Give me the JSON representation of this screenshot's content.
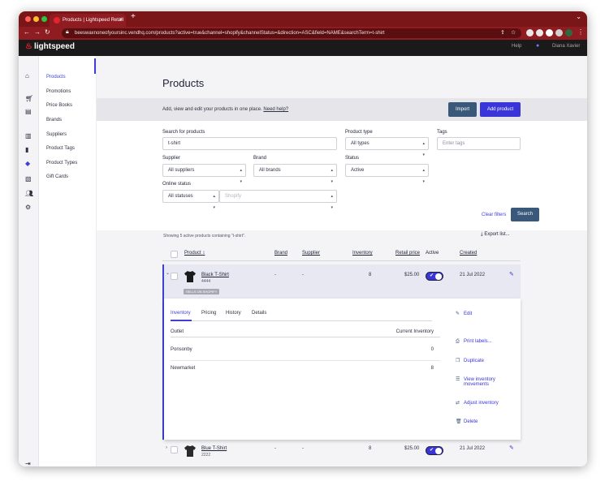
{
  "browser": {
    "tab_title": "Products | Lightspeed Retail",
    "tab_close": "×",
    "new_tab": "+",
    "url": "beeswaxnoneofyoursinc.vendhq.com/products?active=true&channel=shopify&channelStatus=&direction=ASC&field=NAME&searchTerm=t-shirt"
  },
  "appbar": {
    "brand": "lightspeed",
    "help": "Help",
    "user": "Diana Xavier"
  },
  "subnav": {
    "items": [
      {
        "label": "Products"
      },
      {
        "label": "Promotions"
      },
      {
        "label": "Price Books"
      },
      {
        "label": "Brands"
      },
      {
        "label": "Suppliers"
      },
      {
        "label": "Product Tags"
      },
      {
        "label": "Product Types"
      },
      {
        "label": "Gift Cards"
      }
    ]
  },
  "page": {
    "title": "Products",
    "info_text": "Add, view and edit your products in one place.",
    "help_link": "Need help?",
    "import_label": "Import",
    "add_label": "Add product"
  },
  "filters": {
    "search_label": "Search for products",
    "search_value": "t-shirt",
    "product_type_label": "Product type",
    "product_type_value": "All types",
    "tags_label": "Tags",
    "tags_placeholder": "Enter tags",
    "supplier_label": "Supplier",
    "supplier_value": "All suppliers",
    "brand_label": "Brand",
    "brand_value": "All brands",
    "status_label": "Status",
    "status_value": "Active",
    "online_label": "Online status",
    "online_value": "All statuses",
    "channel_value": "Shopify",
    "clear_label": "Clear filters",
    "search_button": "Search"
  },
  "results": {
    "showing_text": "Showing 5 active products containing \"t-shirt\".",
    "export_label": "Export list..."
  },
  "table": {
    "headers": {
      "product": "Product",
      "brand": "Brand",
      "supplier": "Supplier",
      "inventory": "Inventory",
      "retail_price": "Retail price",
      "active": "Active",
      "created": "Created"
    },
    "rows": [
      {
        "name": "Black T-Shirt",
        "sku": "4444",
        "tag": "SELLS ON SHOPIFY",
        "brand": "-",
        "supplier": "-",
        "inventory": "8",
        "price": "$25.00",
        "active": true,
        "created": "21 Jul 2022"
      },
      {
        "name": "Blue T-Shirt",
        "sku": "2222",
        "brand": "-",
        "supplier": "-",
        "inventory": "8",
        "price": "$25.00",
        "active": true,
        "created": "21 Jul 2022"
      }
    ]
  },
  "detail": {
    "tabs": [
      "Inventory",
      "Pricing",
      "History",
      "Details"
    ],
    "outlet_header": "Outlet",
    "current_header": "Current Inventory",
    "outlets": [
      {
        "name": "Ponsonby",
        "qty": "0"
      },
      {
        "name": "Newmarket",
        "qty": "8"
      }
    ],
    "actions": {
      "edit": "Edit",
      "print": "Print labels...",
      "duplicate": "Duplicate",
      "view_inventory_1": "View inventory",
      "view_inventory_2": "movements",
      "adjust": "Adjust inventory",
      "delete": "Delete"
    }
  },
  "colors": {
    "accent": "#3a35d9",
    "brand_red": "#e2242f",
    "primary_dark": "#3a587a",
    "chrome": "#8e1c20"
  },
  "icons": [
    "home-icon",
    "register-icon",
    "sales-icon",
    "reports-icon",
    "products-icon",
    "customers-icon",
    "setup-icon"
  ]
}
